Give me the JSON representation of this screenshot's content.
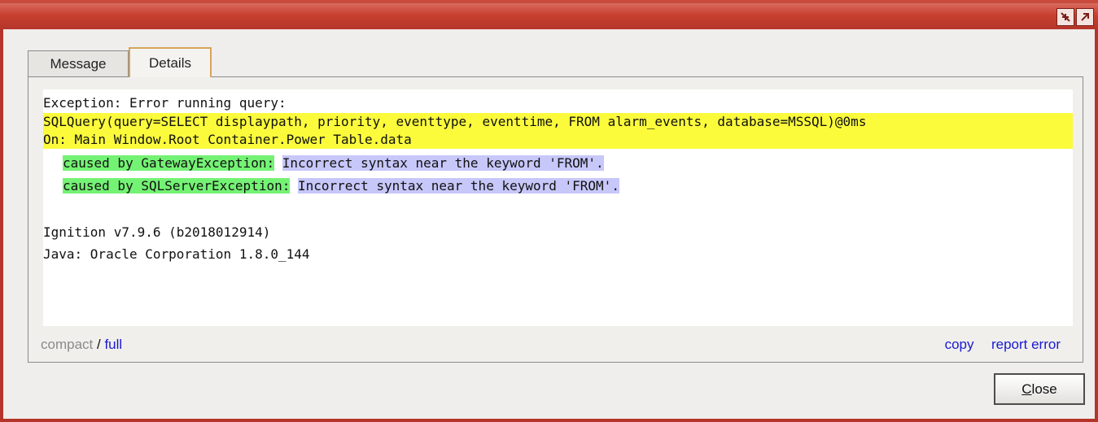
{
  "window": {
    "title_buttons": [
      {
        "icon": "arrows-in-icon"
      },
      {
        "icon": "arrow-out-icon"
      }
    ]
  },
  "tabs": [
    {
      "label": "Message",
      "active": false
    },
    {
      "label": "Details",
      "active": true
    }
  ],
  "details": {
    "line1": "Exception: Error running query:",
    "line2": "SQLQuery(query=SELECT displaypath, priority, eventtype, eventtime, FROM alarm_events, database=MSSQL)@0ms",
    "line3": "On: Main Window.Root Container.Power Table.data",
    "cause1_label": "caused by GatewayException:",
    "cause1_msg": "Incorrect syntax near the keyword 'FROM'.",
    "cause2_label": "caused by SQLServerException:",
    "cause2_msg": "Incorrect syntax near the keyword 'FROM'.",
    "version": "Ignition v7.9.6 (b2018012914)",
    "java": "Java: Oracle Corporation 1.8.0_144"
  },
  "footer": {
    "compact": "compact",
    "separator": "/",
    "full": "full",
    "copy": "copy",
    "report_error": "report error"
  },
  "buttons": {
    "close_first": "C",
    "close_rest": "lose"
  },
  "colors": {
    "titlebar": "#c8402f",
    "highlight_yellow": "#fbfb3c",
    "highlight_green": "#74f274",
    "highlight_blue": "#c7c7fa",
    "link_blue": "#1a1ad1"
  }
}
